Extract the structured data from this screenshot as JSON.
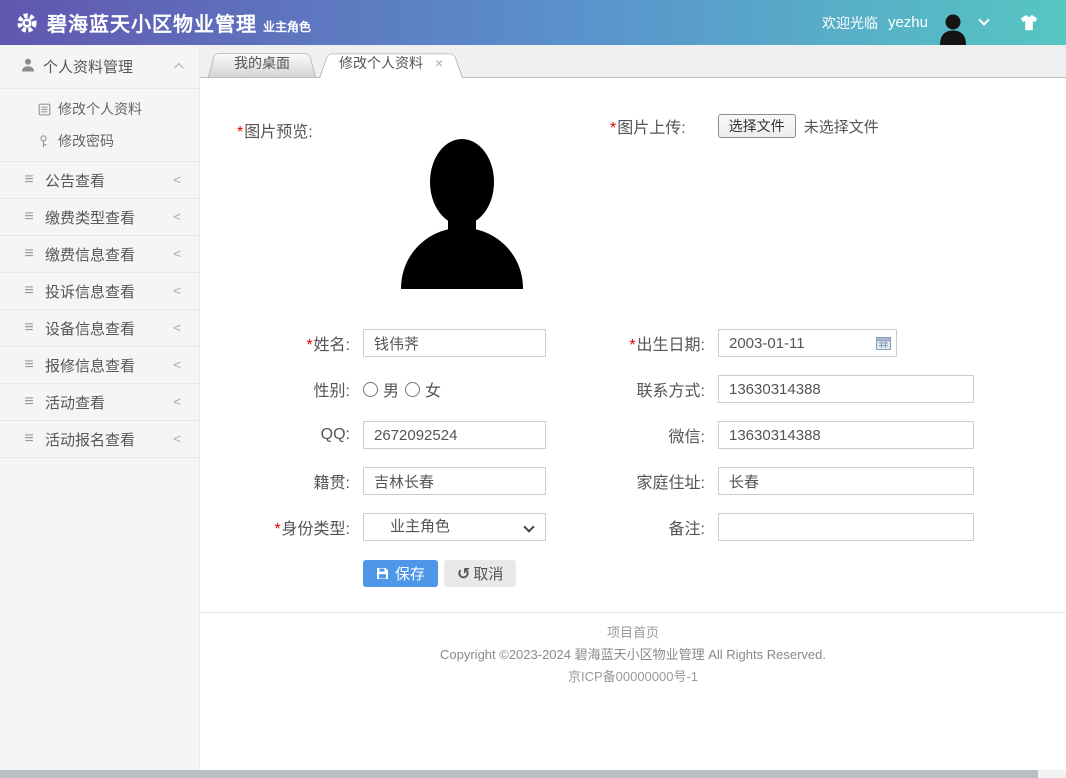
{
  "header": {
    "title": "碧海蓝天小区物业管理",
    "role_badge": "业主角色",
    "welcome": "欢迎光临",
    "username": "yezhu"
  },
  "sidebar": {
    "groups": [
      {
        "label": "个人资料管理",
        "expanded": true,
        "children": [
          {
            "label": "修改个人资料"
          },
          {
            "label": "修改密码"
          }
        ]
      },
      {
        "label": "公告查看"
      },
      {
        "label": "缴费类型查看"
      },
      {
        "label": "缴费信息查看"
      },
      {
        "label": "投诉信息查看"
      },
      {
        "label": "设备信息查看"
      },
      {
        "label": "报修信息查看"
      },
      {
        "label": "活动查看"
      },
      {
        "label": "活动报名查看"
      }
    ]
  },
  "tabs": [
    {
      "label": "我的桌面",
      "active": false
    },
    {
      "label": "修改个人资料",
      "active": true,
      "closable": true
    }
  ],
  "form": {
    "required_mark": "*",
    "preview": {
      "label": "图片预览:"
    },
    "upload": {
      "label": "图片上传:",
      "choose_button": "选择文件",
      "no_file_text": "未选择文件"
    },
    "name": {
      "label": "姓名:",
      "value": "钱伟荠"
    },
    "birth": {
      "label": "出生日期:",
      "value": "2003-01-11"
    },
    "gender": {
      "label": "性别:",
      "options": [
        "男",
        "女"
      ],
      "selected": ""
    },
    "contact": {
      "label": "联系方式:",
      "value": "13630314388"
    },
    "qq": {
      "label": "QQ:",
      "value": "2672092524"
    },
    "wechat": {
      "label": "微信:",
      "value": "13630314388"
    },
    "hometown": {
      "label": "籍贯:",
      "value": "吉林长春"
    },
    "address": {
      "label": "家庭住址:",
      "value": "长春"
    },
    "identity": {
      "label": "身份类型:",
      "value": "业主角色"
    },
    "remark": {
      "label": "备注:",
      "value": ""
    },
    "save_label": "保存",
    "cancel_label": "取消"
  },
  "footer": {
    "home_link": "项目首页",
    "copyright": "Copyright ©2023-2024 碧海蓝天小区物业管理 All Rights Reserved.",
    "icp": "京ICP备00000000号-1"
  },
  "icons": {
    "menu_glyph": "≡",
    "collapse_glyph": "<",
    "close_glyph": "×",
    "undo_glyph": "↺"
  },
  "colors": {
    "header_gradient": [
      "#6156b0",
      "#5a93cd",
      "#55c6c2"
    ],
    "save_button_blue": "#4d96e8",
    "required_red": "#e60000",
    "sidebar_bg": "#f5f5f6"
  }
}
